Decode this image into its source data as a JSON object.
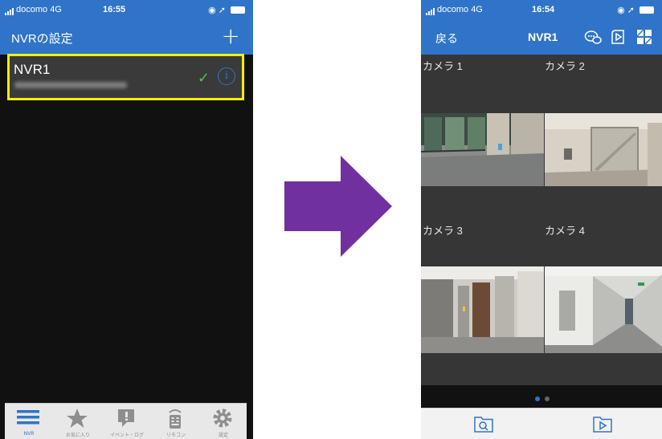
{
  "left_screen": {
    "status": {
      "carrier": "docomo 4G",
      "time": "16:55"
    },
    "nav_title": "NVRの設定",
    "add_icon": "plus-icon",
    "nvr_item": {
      "name": "NVR1",
      "connected": true,
      "check_icon": "check-icon",
      "info_icon": "info-icon"
    },
    "tabs": [
      {
        "label": "NVR",
        "icon": "list-icon",
        "active": true
      },
      {
        "label": "お気に入り",
        "icon": "star-icon"
      },
      {
        "label": "イベント・ログ",
        "icon": "event-log-icon"
      },
      {
        "label": "リモコン",
        "icon": "remote-icon"
      },
      {
        "label": "設定",
        "icon": "gear-icon"
      }
    ]
  },
  "arrow": {
    "icon": "right-arrow-icon",
    "color": "#7030a0"
  },
  "right_screen": {
    "status": {
      "carrier": "docomo 4G",
      "time": "16:54"
    },
    "back_label": "戻る",
    "nav_title": "NVR1",
    "nav_icons": [
      "camera-voice-icon",
      "playback-icon",
      "layout-grid-icon"
    ],
    "cameras": [
      {
        "label": "カメラ 1"
      },
      {
        "label": "カメラ 2"
      },
      {
        "label": "カメラ 3"
      },
      {
        "label": "カメラ 4"
      }
    ],
    "page_dots": {
      "count": 2,
      "active": 0
    },
    "bottom_icons": [
      "search-folder-icon",
      "play-folder-icon"
    ]
  },
  "colors": {
    "accent": "#2f74c8",
    "highlight": "#f4f000",
    "arrow": "#7030a0",
    "check": "#4fc34f"
  }
}
